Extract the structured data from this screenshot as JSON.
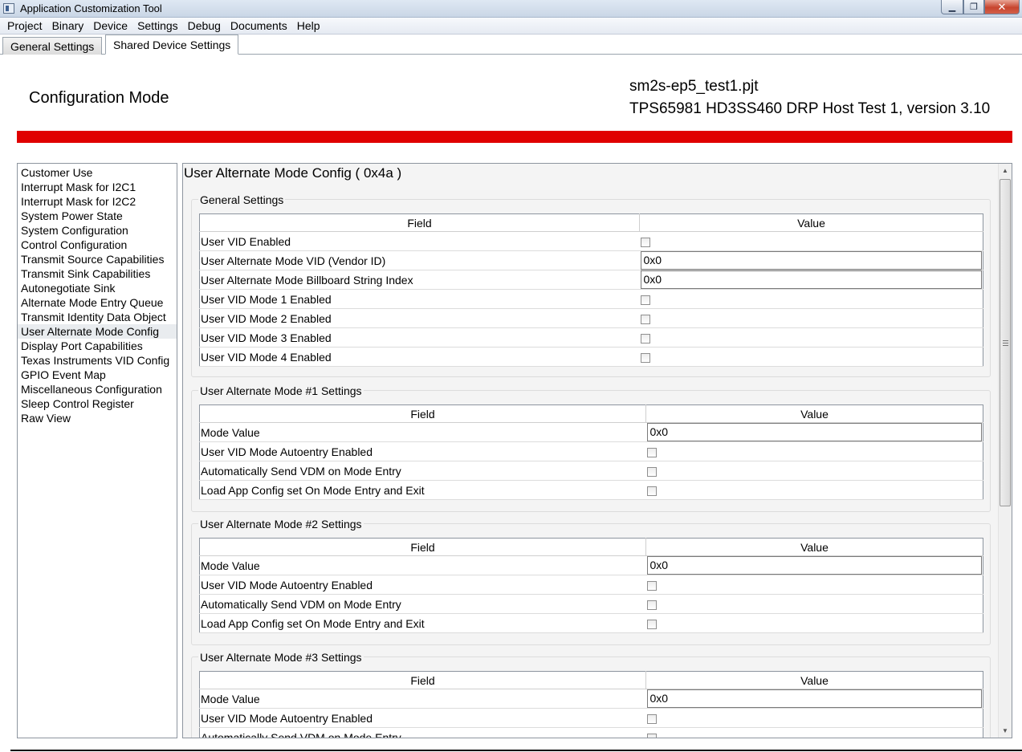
{
  "window": {
    "title": "Application Customization Tool",
    "minimize_glyph": "▁",
    "maximize_glyph": "❐",
    "close_glyph": "✕"
  },
  "menu": [
    "Project",
    "Binary",
    "Device",
    "Settings",
    "Debug",
    "Documents",
    "Help"
  ],
  "tabs": [
    {
      "label": "General Settings",
      "active": false
    },
    {
      "label": "Shared Device Settings",
      "active": true
    }
  ],
  "header": {
    "mode_title": "Configuration Mode",
    "project_file": "sm2s-ep5_test1.pjt",
    "project_desc": "TPS65981 HD3SS460 DRP Host Test 1, version 3.10",
    "accent_color": "#e00000"
  },
  "nav": {
    "items": [
      "Customer Use",
      "Interrupt Mask for I2C1",
      "Interrupt Mask for I2C2",
      "System Power State",
      "System Configuration",
      "Control Configuration",
      "Transmit Source Capabilities",
      "Transmit Sink Capabilities",
      "Autonegotiate Sink",
      "Alternate Mode Entry Queue",
      "Transmit Identity Data Object",
      "User Alternate Mode Config",
      "Display Port Capabilities",
      "Texas Instruments VID Config",
      "GPIO Event Map",
      "Miscellaneous Configuration",
      "Sleep Control Register",
      "Raw View"
    ],
    "selected": "User Alternate Mode Config"
  },
  "content": {
    "title": "User Alternate Mode Config  ( 0x4a )",
    "col_field": "Field",
    "col_value": "Value",
    "sections": [
      {
        "title": "General Settings",
        "rows": [
          {
            "field": "User VID Enabled",
            "type": "checkbox",
            "checked": false
          },
          {
            "field": "User Alternate Mode VID (Vendor ID)",
            "type": "text",
            "value": "0x0"
          },
          {
            "field": "User Alternate Mode Billboard String Index",
            "type": "text",
            "value": "0x0"
          },
          {
            "field": "User VID Mode 1 Enabled",
            "type": "checkbox",
            "checked": false
          },
          {
            "field": "User VID Mode 2 Enabled",
            "type": "checkbox",
            "checked": false
          },
          {
            "field": "User VID Mode 3 Enabled",
            "type": "checkbox",
            "checked": false
          },
          {
            "field": "User VID Mode 4 Enabled",
            "type": "checkbox",
            "checked": false
          }
        ]
      },
      {
        "title": "User Alternate Mode #1 Settings",
        "rows": [
          {
            "field": "Mode Value",
            "type": "text",
            "value": "0x0"
          },
          {
            "field": "User VID Mode Autoentry Enabled",
            "type": "checkbox",
            "checked": false
          },
          {
            "field": "Automatically Send VDM on Mode Entry",
            "type": "checkbox",
            "checked": false
          },
          {
            "field": "Load App Config set On Mode Entry and Exit",
            "type": "checkbox",
            "checked": false
          }
        ]
      },
      {
        "title": "User Alternate Mode #2 Settings",
        "rows": [
          {
            "field": "Mode Value",
            "type": "text",
            "value": "0x0"
          },
          {
            "field": "User VID Mode Autoentry Enabled",
            "type": "checkbox",
            "checked": false
          },
          {
            "field": "Automatically Send VDM on Mode Entry",
            "type": "checkbox",
            "checked": false
          },
          {
            "field": "Load App Config set On Mode Entry and Exit",
            "type": "checkbox",
            "checked": false
          }
        ]
      },
      {
        "title": "User Alternate Mode #3 Settings",
        "rows": [
          {
            "field": "Mode Value",
            "type": "text",
            "value": "0x0"
          },
          {
            "field": "User VID Mode Autoentry Enabled",
            "type": "checkbox",
            "checked": false
          },
          {
            "field": "Automatically Send VDM on Mode Entry",
            "type": "checkbox",
            "checked": false
          }
        ]
      }
    ]
  },
  "scrollbar": {
    "up_glyph": "▲",
    "down_glyph": "▼"
  }
}
